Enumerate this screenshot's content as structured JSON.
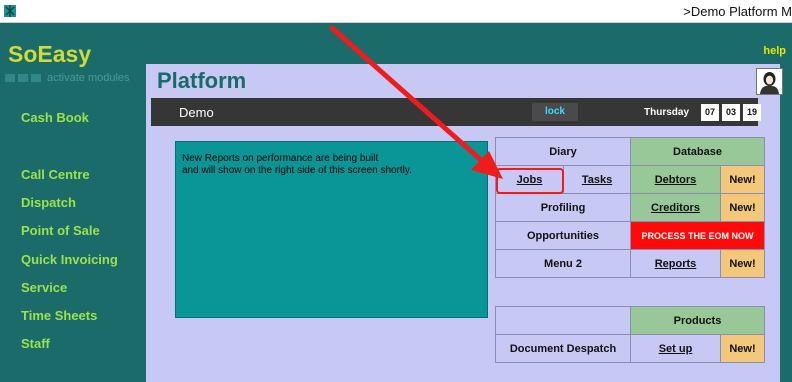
{
  "window": {
    "title": ">Demo Platform M"
  },
  "sidebar": {
    "logo": "SoEasy",
    "subtitle": "activate modules",
    "items": [
      "Cash Book",
      "Call Centre",
      "Dispatch",
      "Point of Sale",
      "Quick Invoicing",
      "Service",
      "Time Sheets",
      "Staff"
    ]
  },
  "header": {
    "help": "help",
    "title": "Platform"
  },
  "infobar": {
    "company": "Demo",
    "lock": "lock",
    "day": "Thursday",
    "date": [
      "07",
      "03",
      "19"
    ]
  },
  "reports": {
    "line1": "New Reports on performance are being built",
    "line2": "and will show on the right side of this screen shortly."
  },
  "grid": {
    "diary": "Diary",
    "database": "Database",
    "jobs": "Jobs",
    "tasks": "Tasks",
    "debtors": "Debtors",
    "new1": "New!",
    "profiling": "Profiling",
    "creditors": "Creditors",
    "new2": "New!",
    "opportunities": "Opportunities",
    "process_eom": "PROCESS THE EOM NOW",
    "menu2": "Menu 2",
    "reports": "Reports",
    "new3": "New!"
  },
  "grid2": {
    "products": "Products",
    "document_despatch": "Document Despatch",
    "setup": "Set up",
    "new4": "New!"
  },
  "colors": {
    "sidebar_bg": "#1b6b6b",
    "logo": "#cddc39",
    "nav_text": "#9be34a",
    "main_bg": "#c8c8f4",
    "reports_bg": "#0a9696",
    "green_cell": "#98c898",
    "orange_cell": "#f4c87a",
    "alert": "#ff0a0a",
    "annotation": "#ee1c1c"
  }
}
